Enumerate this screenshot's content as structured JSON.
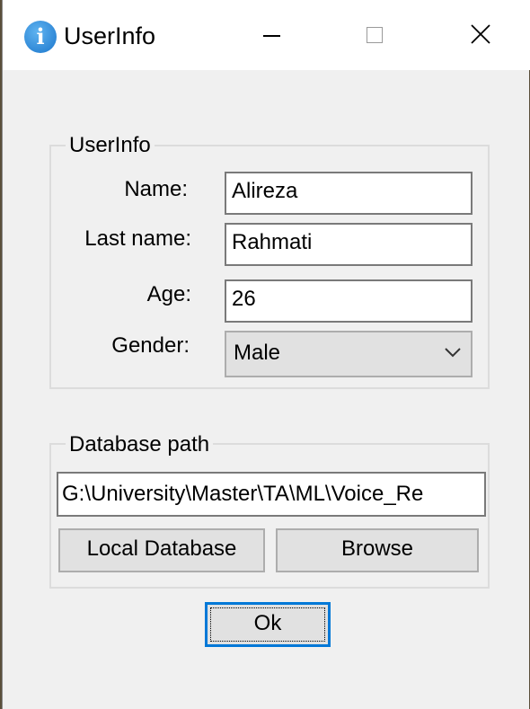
{
  "window": {
    "title": "UserInfo",
    "app_icon_glyph": "i",
    "controls": [
      "minimize-icon",
      "maximize-icon",
      "close-icon"
    ]
  },
  "user_group": {
    "legend": "UserInfo",
    "name_label": "Name:",
    "name_value": "Alireza",
    "lastname_label": "Last name:",
    "lastname_value": "Rahmati",
    "age_label": "Age:",
    "age_value": "26",
    "gender_label": "Gender:",
    "gender_value": "Male"
  },
  "db_group": {
    "legend": "Database path",
    "path_value": "G:\\University\\Master\\TA\\ML\\Voice_Re",
    "local_db_label": "Local Database",
    "browse_label": "Browse"
  },
  "ok_label": "Ok",
  "colors": {
    "window_bg": "#f0f0f0",
    "titlebar_bg": "#ffffff",
    "focus_accent": "#0078d7"
  }
}
